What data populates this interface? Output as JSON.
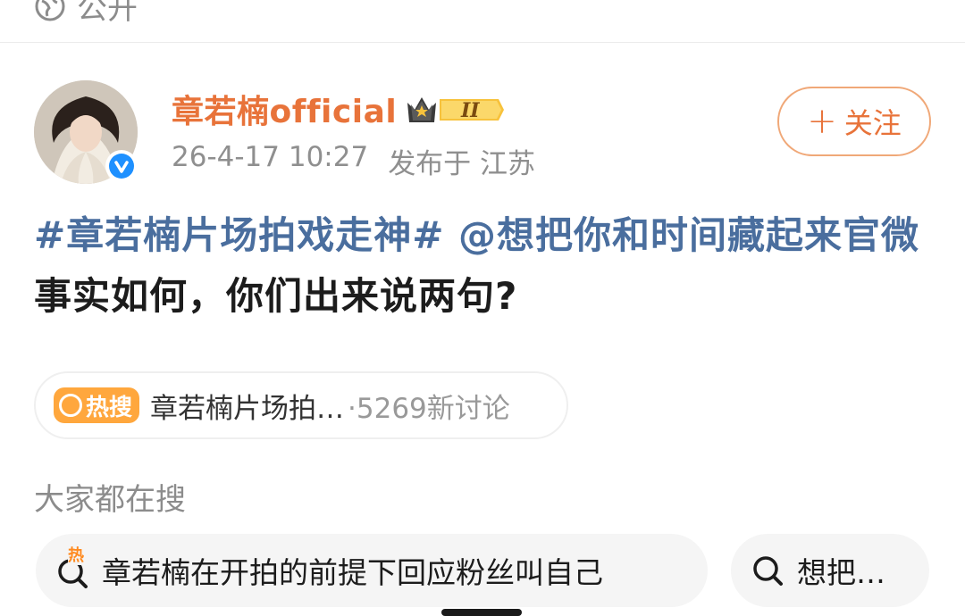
{
  "visibility": {
    "label": "公开",
    "icon": "globe-icon"
  },
  "post": {
    "username": "章若楠official",
    "member_badge": "II",
    "timestamp": "26-4-17 10:27",
    "location": "发布于 江苏",
    "follow_label": "关注",
    "text_hashtag": "#章若楠片场拍戏走神#",
    "text_mention": "@想把你和时间藏起来官微",
    "text_body": "事实如何，你们出来说两句?"
  },
  "hot_search": {
    "tag": "热搜",
    "title": "章若楠片场拍…",
    "count": "·5269新讨论"
  },
  "related": {
    "label": "大家都在搜",
    "items": [
      {
        "hot_mark": "热",
        "text": "章若楠在开拍的前提下回应粉丝叫自己"
      },
      {
        "text": "想把…"
      }
    ]
  },
  "colors": {
    "accent": "#e8733a",
    "link": "#4a6e9e",
    "hot": "#ffa73d"
  }
}
